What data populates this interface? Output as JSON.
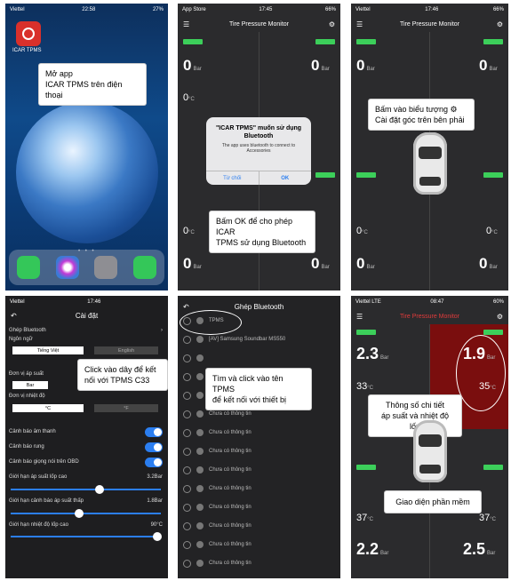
{
  "p1": {
    "carrier": "Viettel",
    "time": "22:58",
    "battery": "27%",
    "app_label": "ICAR TPMS",
    "callout": [
      "Mở app",
      "ICAR TPMS trên điện thoại"
    ]
  },
  "p2": {
    "carrier": "App Store",
    "time": "17:45",
    "battery": "66%",
    "title": "Tire Pressure Monitor",
    "values": [
      "0",
      "0",
      "0",
      "0"
    ],
    "temps": [
      "0",
      "0"
    ],
    "unit_p": "Bar",
    "unit_t": "°C",
    "dialog": {
      "title": "\"ICAR TPMS\" muốn sử dụng Bluetooth",
      "body": "The app uses bluetooth to connect to Accessories",
      "deny": "Từ chối",
      "ok": "OK"
    },
    "callout": [
      "Bấm OK để cho phép ICAR",
      "TPMS sử dụng Bluetooth"
    ]
  },
  "p3": {
    "carrier": "Viettel",
    "time": "17:46",
    "battery": "66%",
    "title": "Tire Pressure Monitor",
    "values": [
      "0",
      "0",
      "0",
      "0"
    ],
    "temps": [
      "0",
      "0"
    ],
    "callout": [
      "Bấm vào biểu tượng ⚙",
      "Cài đặt góc trên bên phải"
    ]
  },
  "p4": {
    "carrier": "Viettel",
    "time": "17:46",
    "title": "Cài đặt",
    "rows": {
      "pair": "Ghép Bluetooth",
      "lang": "Ngôn ngữ",
      "lang_val": "Tiếng Việt",
      "lang_alt": "English",
      "p_unit": "Đơn vị áp suất",
      "p_val": "Bar",
      "t_unit": "Đơn vị nhiệt độ",
      "t_val": "°C",
      "t_alt": "°F",
      "alarm_sound": "Cảnh báo âm thanh",
      "alarm_vib": "Cảnh báo rung",
      "alarm_obd": "Cảnh báo giọng nói trên OBD",
      "hi_p": "Giới hạn áp suất lốp cao",
      "hi_p_val": "3.2Bar",
      "lo_p": "Giới hạn cảnh báo áp suất thấp",
      "lo_p_val": "1.8Bar",
      "hi_t": "Giới hạn nhiệt độ lốp cao",
      "hi_t_val": "90°C"
    },
    "callout": [
      "Click vào dây để kết",
      "nối với TPMS C33"
    ]
  },
  "p5": {
    "title": "Ghép Bluetooth",
    "items": [
      "TPMS",
      "[AV] Samsung Soundbar MS550",
      "",
      "",
      "Chưa có thông tin",
      "Chưa có thông tin",
      "Chưa có thông tin",
      "Chưa có thông tin",
      "Chưa có thông tin",
      "Chưa có thông tin",
      "Chưa có thông tin",
      "Chưa có thông tin",
      "Chưa có thông tin",
      "Chưa có thông tin"
    ],
    "callout": [
      "Tìm và click vào tên TPMS",
      "để kết nối với thiết bị"
    ]
  },
  "p6": {
    "carrier": "Viettel",
    "lte": "LTE",
    "time": "08:47",
    "battery": "60%",
    "title": "Tire Pressure Monitor",
    "fl": "2.3",
    "fr": "1.9",
    "rl": "2.2",
    "rr": "2.5",
    "tfl": "33",
    "tfr": "35",
    "trl": "37",
    "trr": "37",
    "unit_p": "Bar",
    "unit_t": "°C",
    "callout1": [
      "Thông số chi tiết",
      "áp suất và nhiệt độ lốp"
    ],
    "callout2": "Giao diện phần mềm"
  },
  "colors": {
    "green": "#3ccf5a",
    "red_panel": "#7a0e0e",
    "blue": "#2b7ef0"
  }
}
